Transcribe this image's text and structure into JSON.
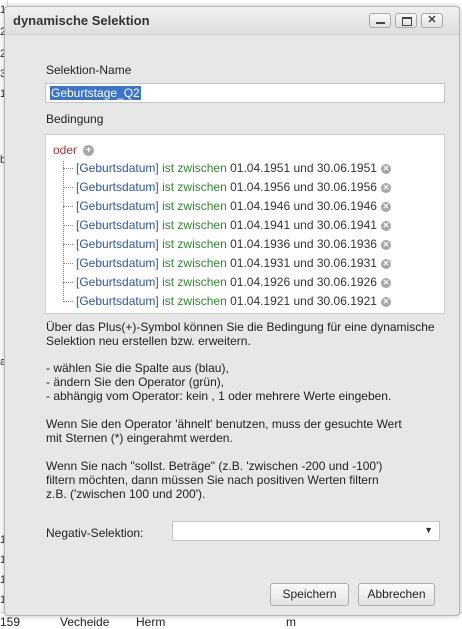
{
  "window": {
    "title": "dynamische Selektion"
  },
  "form": {
    "name_label": "Selektion-Name",
    "name_value": "Geburtstage_Q2",
    "condition_label": "Bedingung",
    "condition_root": "oder",
    "conditions": [
      {
        "column": "[Geburtsdatum]",
        "operator": "ist zwischen",
        "from": "01.04.1951",
        "and": "und",
        "to": "30.06.1951"
      },
      {
        "column": "[Geburtsdatum]",
        "operator": "ist zwischen",
        "from": "01.04.1956",
        "and": "und",
        "to": "30.06.1956"
      },
      {
        "column": "[Geburtsdatum]",
        "operator": "ist zwischen",
        "from": "01.04.1946",
        "and": "und",
        "to": "30.06.1946"
      },
      {
        "column": "[Geburtsdatum]",
        "operator": "ist zwischen",
        "from": "01.04.1941",
        "and": "und",
        "to": "30.06.1941"
      },
      {
        "column": "[Geburtsdatum]",
        "operator": "ist zwischen",
        "from": "01.04.1936",
        "and": "und",
        "to": "30.06.1936"
      },
      {
        "column": "[Geburtsdatum]",
        "operator": "ist zwischen",
        "from": "01.04.1931",
        "and": "und",
        "to": "30.06.1931"
      },
      {
        "column": "[Geburtsdatum]",
        "operator": "ist zwischen",
        "from": "01.04.1926",
        "and": "und",
        "to": "30.06.1926"
      },
      {
        "column": "[Geburtsdatum]",
        "operator": "ist zwischen",
        "from": "01.04.1921",
        "and": "und",
        "to": "30.06.1921"
      }
    ],
    "help_1": "Über das Plus(+)-Symbol können Sie die Bedingung für eine dynamische\nSelektion neu erstellen bzw. erweitern.",
    "help_2": "- wählen Sie die Spalte aus (blau),\n- ändern Sie den Operator (grün),\n- abhängig vom Operator: kein , 1 oder mehrere Werte eingeben.",
    "help_3": "Wenn Sie den Operator 'ähnelt' benutzen, muss der gesuchte Wert\nmit Sternen (*) eingerahmt werden.",
    "help_4": "Wenn Sie nach \"sollst. Beträge\" (z.B. 'zwischen -200 und -100')\nfiltern möchten, dann müssen Sie nach positiven Werten filtern\nz.B. ('zwischen 100 und 200').",
    "negative_label": "Negativ-Selektion:",
    "negative_value": ""
  },
  "buttons": {
    "save": "Speichern",
    "cancel": "Abbrechen"
  },
  "background": {
    "left_cells": [
      "1",
      "2",
      "2",
      "3",
      "1",
      "b",
      "a",
      "1",
      "1",
      "1",
      "1"
    ],
    "bottom_row": [
      "159",
      "Vecheide",
      "Herm",
      "m"
    ]
  },
  "colors": {
    "column": "#2b55a8",
    "operator": "#2e8a2e",
    "root": "#b03030",
    "selection": "#3b74c9"
  }
}
